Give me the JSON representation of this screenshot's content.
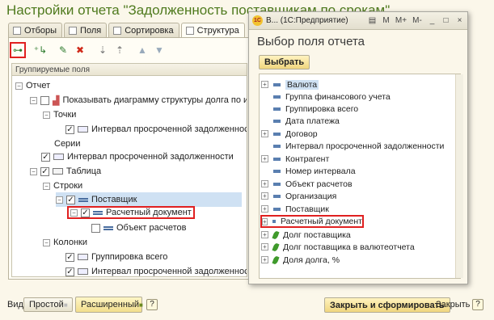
{
  "main": {
    "title": "Настройки отчета \"Задолженность поставщикам по срокам\"",
    "tabs": [
      {
        "label": "Отборы"
      },
      {
        "label": "Поля"
      },
      {
        "label": "Сортировка"
      },
      {
        "label": "Структура"
      }
    ],
    "tree_header": "Группируемые поля",
    "tree_rows": [
      {
        "label": "Отчет"
      },
      {
        "label": "Показывать диаграмму структуры долга по интервалам"
      },
      {
        "label": "Точки"
      },
      {
        "label": "Интервал просроченной задолженности"
      },
      {
        "label": "Серии"
      },
      {
        "label": "Интервал просроченной задолженности"
      },
      {
        "label": "Таблица"
      },
      {
        "label": "Строки"
      },
      {
        "label": "Поставщик"
      },
      {
        "label": "Расчетный документ"
      },
      {
        "label": "Объект расчетов"
      },
      {
        "label": "Колонки"
      },
      {
        "label": "Группировка всего"
      },
      {
        "label": "Интервал просроченной задолженности, Номе..."
      }
    ],
    "bottom": {
      "view_label": "Вид:",
      "simple_label": "Простой",
      "extended_label": "Расширенный",
      "help_glyph": "?",
      "close_generate_label": "Закрыть и сформировать",
      "close_label": "Закрыть"
    }
  },
  "dialog": {
    "window_title": "В... (1С:Предприятие)",
    "logo_text": "1С",
    "heading": "Выбор поля отчета",
    "choose_label": "Выбрать",
    "title_buttons": [
      "М",
      "М+",
      "М-"
    ],
    "fields": [
      {
        "label": "Валюта"
      },
      {
        "label": "Группа финансового учета"
      },
      {
        "label": "Группировка всего"
      },
      {
        "label": "Дата платежа"
      },
      {
        "label": "Договор"
      },
      {
        "label": "Интервал просроченной задолженности"
      },
      {
        "label": "Контрагент"
      },
      {
        "label": "Номер интервала"
      },
      {
        "label": "Объект расчетов"
      },
      {
        "label": "Организация"
      },
      {
        "label": "Поставщик"
      },
      {
        "label": "Расчетный документ"
      },
      {
        "label": "Долг поставщика"
      },
      {
        "label": "Долг поставщика в валютеотчета"
      },
      {
        "label": "Доля долга, %"
      }
    ]
  },
  "colors": {
    "title_green": "#4f7a1e",
    "highlight_red": "#e02020",
    "selection_blue": "#cfe1f3"
  }
}
